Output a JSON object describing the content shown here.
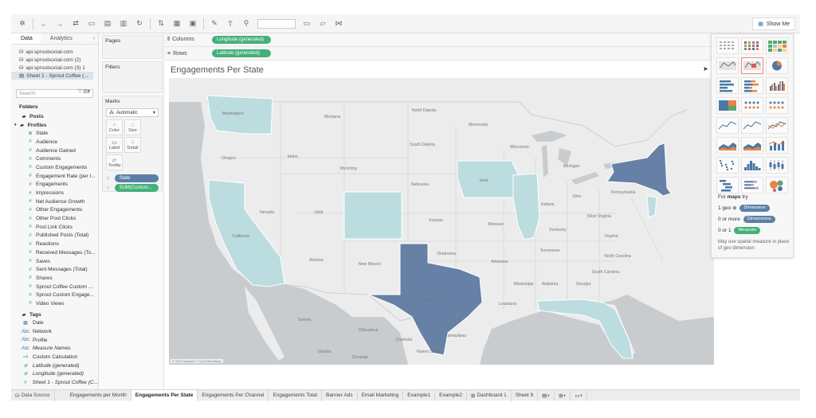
{
  "toolbar": {
    "show_me_label": "Show Me"
  },
  "data_pane": {
    "tabs": [
      "Data",
      "Analytics"
    ],
    "collapse_glyph": "‹",
    "data_sources": [
      "api.sproutsocial.com",
      "api.sproutsocial.com (2)",
      "api.sproutsocial.com (3) 1",
      "Sheet 1 - Sprout Coffee (..."
    ],
    "search_placeholder": "Search",
    "folders_label": "Folders",
    "posts_label": "Posts",
    "profiles_label": "Profiles",
    "profile_fields": [
      "State",
      "Audience",
      "Audience Gained",
      "Comments",
      "Custom Engagements",
      "Engagement Rate (per I...",
      "Engagements",
      "Impressions",
      "Net Audience Growth",
      "Other Engagements",
      "Other Post Clicks",
      "Post Link Clicks",
      "Published Posts (Total)",
      "Reactions",
      "Received Messages (To...",
      "Saves",
      "Sent Messages (Total)",
      "Shares",
      "Sprout Coffee Custom ...",
      "Sprout Custom Engage...",
      "Video Views"
    ],
    "tags_label": "Tags",
    "tag_fields": [
      "Date",
      "Network",
      "Profile",
      "Measure Names",
      "Custom Calculation",
      "Latitude (generated)",
      "Longitude (generated)",
      "Sheet 1 - Sprout Coffee (C..."
    ]
  },
  "cards": {
    "pages": "Pages",
    "filters": "Filters",
    "marks": "Marks",
    "mark_type": "Automatic",
    "buttons": [
      "Color",
      "Size",
      "Label",
      "Detail",
      "Tooltip"
    ],
    "pill_state": "State",
    "pill_sum": "SUM(Custom..."
  },
  "shelves": {
    "columns_label": "Columns",
    "rows_label": "Rows",
    "columns_pill": "Longitude (generated)",
    "rows_pill": "Latitude (generated)"
  },
  "view": {
    "title": "Engagements Per State",
    "map_credit": "© 2022 Mapbox © OpenStreetMap",
    "labels": {
      "Washington": "Washington",
      "Oregon": "Oregon",
      "Idaho": "Idaho",
      "Montana": "Montana",
      "Wyoming": "Wyoming",
      "Nevada": "Nevada",
      "Utah": "Utah",
      "California": "California",
      "Arizona": "Arizona",
      "NewMexico": "New Mexico",
      "NorthDakota": "North Dakota",
      "SouthDakota": "South Dakota",
      "Nebraska": "Nebraska",
      "Kansas": "Kansas",
      "Oklahoma": "Oklahoma",
      "Texas": "Texas",
      "Minnesota": "Minnesota",
      "Wisconsin": "Wisconsin",
      "Iowa": "Iowa",
      "Missouri": "Missouri",
      "Arkansas": "Arkansas",
      "Louisiana": "Louisiana",
      "Mississippi": "Mississippi",
      "Alabama": "Alabama",
      "Georgia": "Georgia",
      "Tennessee": "Tennessee",
      "Kentucky": "Kentucky",
      "Indiana": "Indiana",
      "Ohio": "Ohio",
      "Michigan": "Michigan",
      "Pennsylvania": "Pennsylvania",
      "Virginia": "Virginia",
      "NorthCarolina": "North Carolina",
      "SouthCarolina": "South Carolina",
      "WestVirginia": "West Virginia",
      "Chihuahua": "Chihuahua",
      "Coahuila": "Coahuila",
      "Sonora": "Sonora",
      "NuevoLeon": "Nuevo León",
      "Tamaulipas": "Tamaulipas",
      "Durango": "Durango",
      "Sinaloa": "Sinaloa"
    }
  },
  "show_me": {
    "for_maps_prefix": "For ",
    "for_maps_bold": "maps",
    "for_maps_suffix": " try",
    "line1_text": "1 geo",
    "line1_pill": "Dimension",
    "line2_text": "0 or more",
    "line2_pill": "Dimensions",
    "line3_text": "0 or 1",
    "line3_pill": "Measure",
    "note": "May use spatial measure in place of geo dimension"
  },
  "bottom_tabs": {
    "data_source": "Data Source",
    "sheets": [
      "Engagements per Month",
      "Engagements Per State",
      "Engagements Per Channel",
      "Engagements Total",
      "Banner Ads",
      "Email Marketing",
      "Example1",
      "Example2",
      "Dashboard 1",
      "Sheet 9"
    ]
  },
  "colors": {
    "state_light": "#bcdde0",
    "state_dark": "#6680a6",
    "dimension_pill": "#5b80a8",
    "measure_pill": "#44b07a",
    "water": "#c9cccf",
    "land": "#ececec"
  }
}
